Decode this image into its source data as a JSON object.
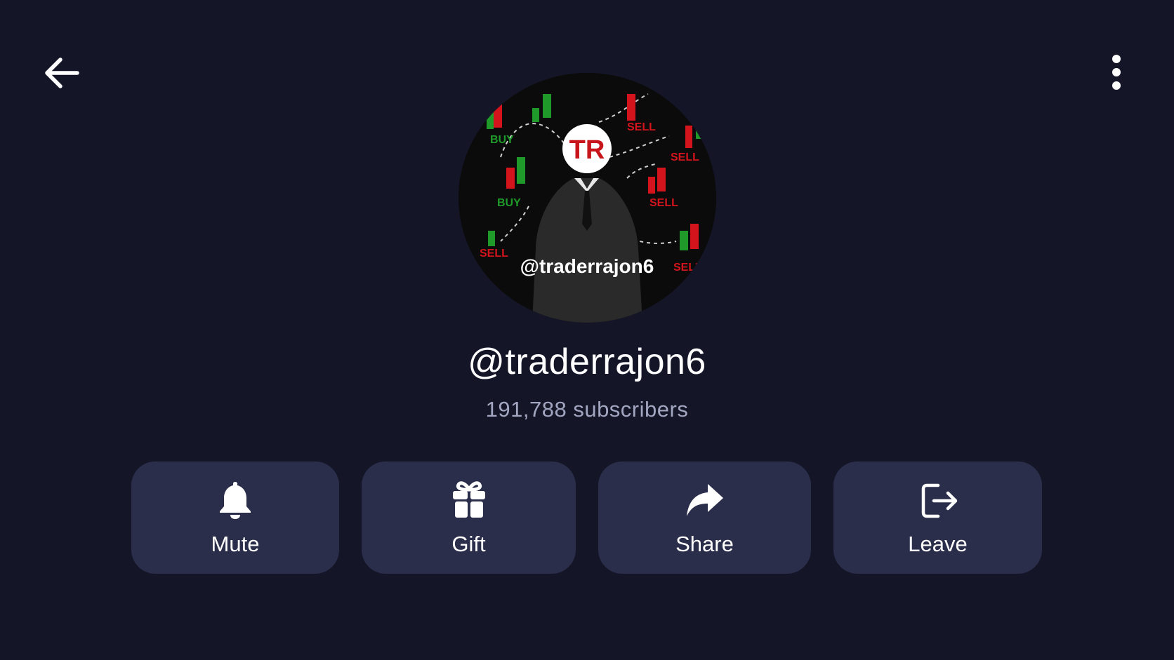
{
  "channel": {
    "name": "@traderrajon6",
    "subscribers": "191,788 subscribers"
  },
  "header": {
    "back_icon": "arrow-left-icon",
    "menu_icon": "more-vertical-icon"
  },
  "avatar": {
    "initials": "TR",
    "handle": "@traderrajon6",
    "labels": [
      "BUY",
      "BUY",
      "SELL",
      "SELL",
      "SELL",
      "SELL",
      "SELL"
    ],
    "colors": {
      "buy": "#1f9a2a",
      "sell": "#d4141c",
      "badge": "#ffffff",
      "background": "#0b0b0b"
    }
  },
  "actions": [
    {
      "label": "Mute",
      "icon": "bell-icon"
    },
    {
      "label": "Gift",
      "icon": "gift-icon"
    },
    {
      "label": "Share",
      "icon": "share-arrow-icon"
    },
    {
      "label": "Leave",
      "icon": "logout-icon"
    }
  ],
  "colors": {
    "background": "#141628",
    "button": "#2b2e4a",
    "subtext": "#a3a6c0",
    "text": "#ffffff"
  }
}
